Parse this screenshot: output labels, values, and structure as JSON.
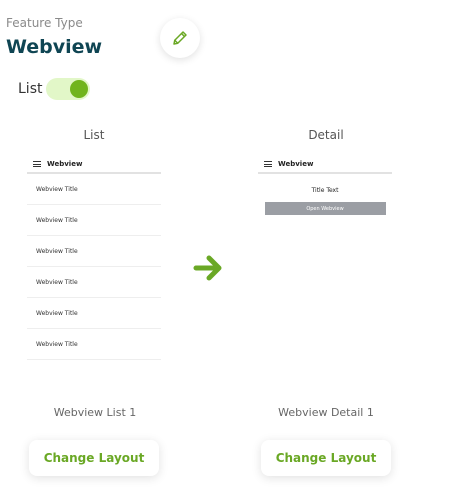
{
  "header": {
    "feature_label": "Feature Type",
    "feature_title": "Webview",
    "edit_icon": "pencil-icon"
  },
  "toggle": {
    "label": "List",
    "state": "on"
  },
  "list_column": {
    "title": "List",
    "screen_title": "Webview",
    "items": [
      "Webview Title",
      "Webview Title",
      "Webview Title",
      "Webview Title",
      "Webview Title",
      "Webview Title"
    ],
    "caption": "Webview List 1",
    "button_label": "Change Layout"
  },
  "detail_column": {
    "title": "Detail",
    "screen_title": "Webview",
    "body_title": "Title Text",
    "open_button_label": "Open Webview",
    "caption": "Webview Detail 1",
    "button_label": "Change Layout"
  },
  "colors": {
    "accent": "#6aa825",
    "title": "#0f4553"
  }
}
